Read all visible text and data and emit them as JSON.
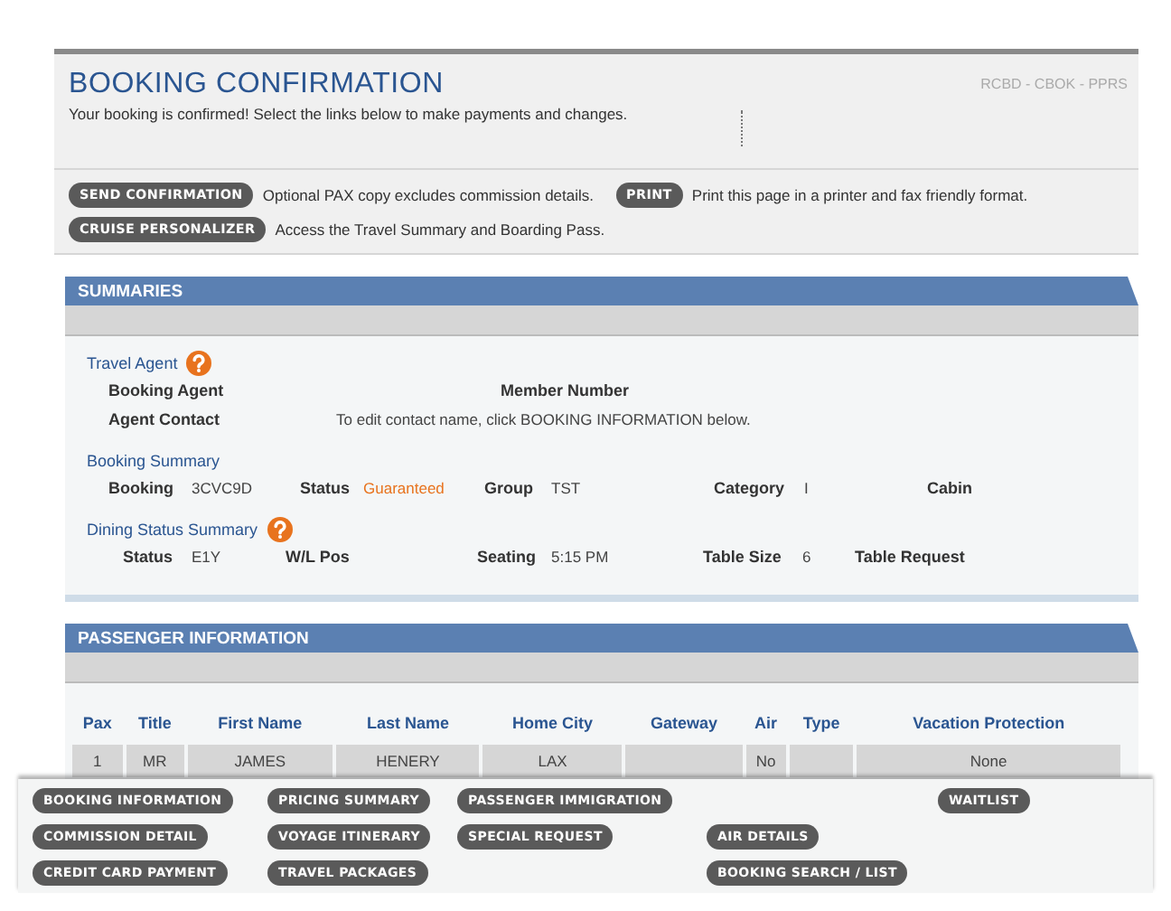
{
  "header": {
    "title": "BOOKING CONFIRMATION",
    "codes": "RCBD - CBOK - PPRS",
    "message": "Your booking is confirmed! Select the links below to make payments and changes."
  },
  "actions": [
    {
      "label": "SEND CONFIRMATION",
      "note": "Optional PAX copy excludes commission details."
    },
    {
      "label": "PRINT",
      "note": "Print this page in a printer and fax friendly format."
    },
    {
      "label": "CRUISE PERSONALIZER",
      "note": "Access the Travel Summary and Boarding Pass."
    }
  ],
  "summaries": {
    "title": "SUMMARIES",
    "travel_agent": {
      "heading": "Travel Agent",
      "booking_agent": "Booking Agent",
      "member_number": "Member Number",
      "agent_contact": "Agent Contact",
      "contact_note": "To edit contact name, click BOOKING INFORMATION below."
    },
    "booking_summary": {
      "heading": "Booking Summary",
      "fields": [
        {
          "label": "Booking",
          "value": "3CVC9D"
        },
        {
          "label": "Status",
          "value": "Guaranteed",
          "kind": "status"
        },
        {
          "label": "Group",
          "value": "TST"
        },
        {
          "label": "Category",
          "value": "I"
        },
        {
          "label": "Cabin"
        }
      ]
    },
    "dining_summary": {
      "heading": "Dining Status Summary",
      "fields": [
        {
          "label": "Status",
          "value": "E1Y"
        },
        {
          "label": "W/L Pos"
        },
        {
          "label": "Seating",
          "value": "5:15 PM"
        },
        {
          "label": "Table Size",
          "value": "6"
        },
        {
          "label": "Table Request"
        }
      ]
    }
  },
  "passengers": {
    "title": "PASSENGER INFORMATION",
    "columns": [
      "Pax",
      "Title",
      "First Name",
      "Last Name",
      "Home City",
      "Gateway",
      "Air",
      "Type",
      "Vacation Protection"
    ],
    "rows": [
      [
        "1",
        "MR",
        "JAMES",
        "HENERY",
        "LAX",
        null,
        "No",
        null,
        "None"
      ]
    ]
  },
  "footer_links": [
    "BOOKING INFORMATION",
    "PRICING SUMMARY",
    "PASSENGER IMMIGRATION",
    "WAITLIST",
    "COMMISSION DETAIL",
    "VOYAGE ITINERARY",
    "SPECIAL REQUEST",
    "AIR DETAILS",
    "CREDIT CARD PAYMENT",
    "TRAVEL PACKAGES",
    "BOOKING SEARCH / LIST"
  ]
}
